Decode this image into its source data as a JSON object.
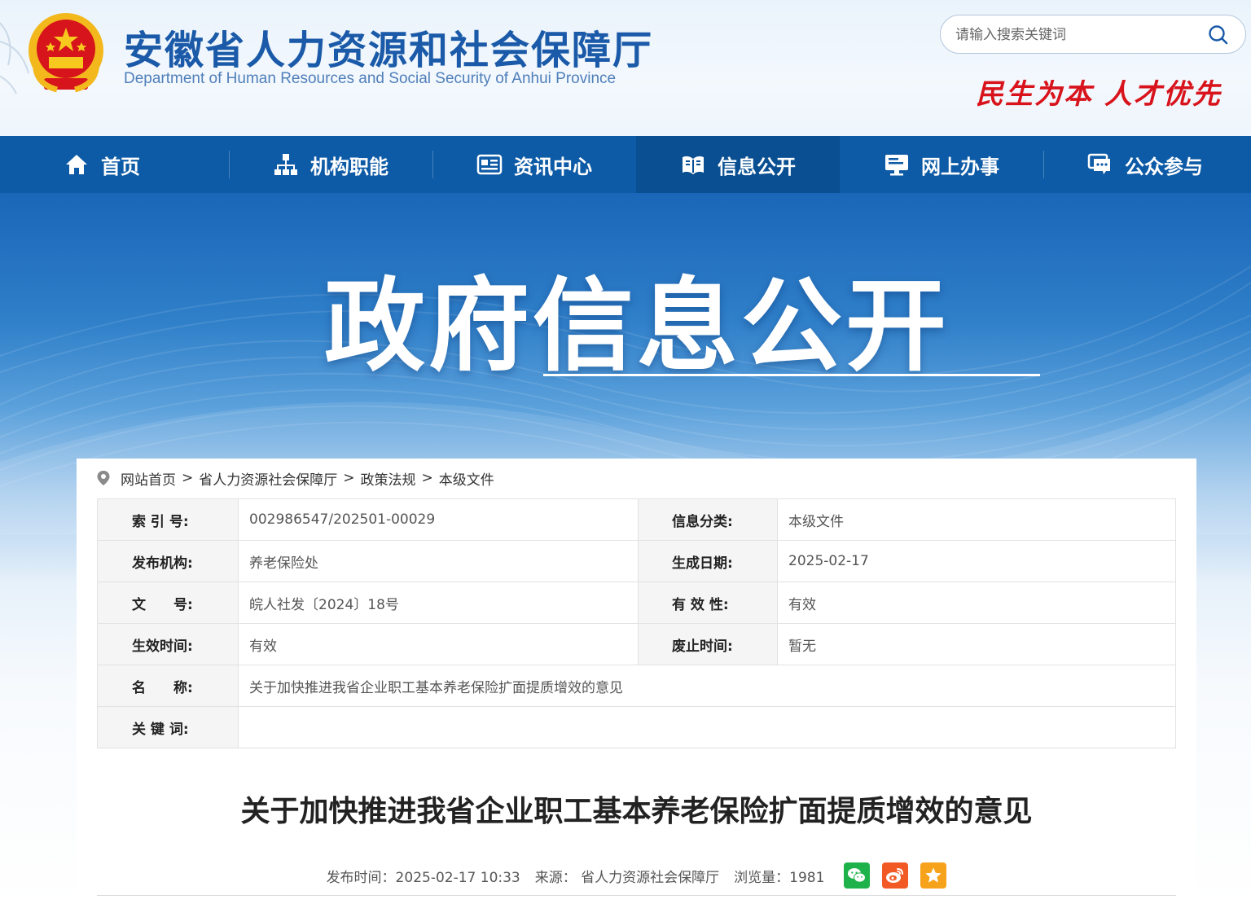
{
  "header": {
    "site_title": "安徽省人力资源和社会保障厅",
    "site_subtitle": "Department of Human Resources and Social Security of Anhui Province",
    "search_placeholder": "请输入搜索关键词",
    "slogan": "民生为本  人才优先",
    "emblem_icon": "national-emblem-icon"
  },
  "nav": {
    "items": [
      {
        "label": "首页",
        "icon": "home-icon"
      },
      {
        "label": "机构职能",
        "icon": "org-chart-icon"
      },
      {
        "label": "资讯中心",
        "icon": "news-icon"
      },
      {
        "label": "信息公开",
        "icon": "open-book-icon",
        "active": true
      },
      {
        "label": "网上办事",
        "icon": "monitor-icon"
      },
      {
        "label": "公众参与",
        "icon": "chat-icon"
      }
    ],
    "active_color": "#094f92",
    "bar_color": "#0d5aa6"
  },
  "banner": {
    "title": "政府信息公开"
  },
  "breadcrumb": {
    "items": [
      "网站首页",
      "省人力资源社会保障厅",
      "政策法规",
      "本级文件"
    ],
    "separator": ">"
  },
  "meta": {
    "index_label": "索 引 号:",
    "index_value": "002986547/202501-00029",
    "category_label": "信息分类:",
    "category_value": "本级文件",
    "publisher_label": "发布机构:",
    "publisher_value": "养老保险处",
    "date_label": "生成日期:",
    "date_value": "2025-02-17",
    "docno_label": "文　　号:",
    "docno_value": "皖人社发〔2024〕18号",
    "validity_label": "有 效 性:",
    "validity_value": "有效",
    "effective_label": "生效时间:",
    "effective_value": "有效",
    "repeal_label": "废止时间:",
    "repeal_value": "暂无",
    "name_label": "名　　称:",
    "name_value": "关于加快推进我省企业职工基本养老保险扩面提质增效的意见",
    "keywords_label": "关 键 词:",
    "keywords_value": ""
  },
  "article": {
    "title": "关于加快推进我省企业职工基本养老保险扩面提质增效的意见",
    "publish_time": "发布时间：2025-02-17 10:33",
    "source": "来源：  省人力资源社会保障厅",
    "views": "浏览量：1981"
  }
}
